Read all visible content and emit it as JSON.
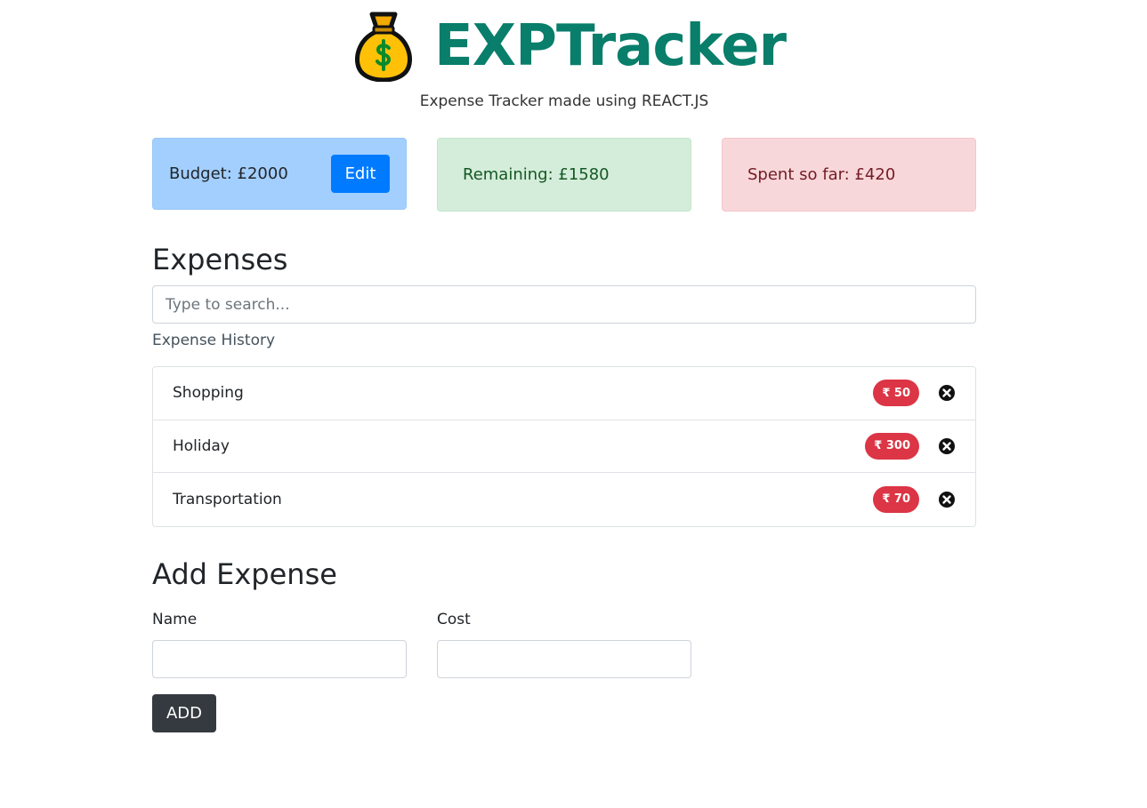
{
  "header": {
    "logo_icon": "money-bag-icon",
    "title": "EXPTracker",
    "subtitle": "Expense Tracker made using REACT.JS",
    "title_color": "#087e6b"
  },
  "cards": {
    "budget_text": "Budget: £2000",
    "edit_label": "Edit",
    "remaining_text": "Remaining: £1580",
    "spent_text": "Spent so far: £420"
  },
  "expenses": {
    "heading": "Expenses",
    "search_placeholder": "Type to search...",
    "search_value": "",
    "history_label": "Expense History",
    "items": [
      {
        "name": "Shopping",
        "cost": "₹ 50",
        "delete_icon": "close-circle-icon"
      },
      {
        "name": "Holiday",
        "cost": "₹ 300",
        "delete_icon": "close-circle-icon"
      },
      {
        "name": "Transportation",
        "cost": "₹ 70",
        "delete_icon": "close-circle-icon"
      }
    ],
    "badge_color": "#dc3545"
  },
  "add_expense": {
    "heading": "Add Expense",
    "name_label": "Name",
    "name_value": "",
    "cost_label": "Cost",
    "cost_value": "",
    "add_label": "ADD"
  }
}
